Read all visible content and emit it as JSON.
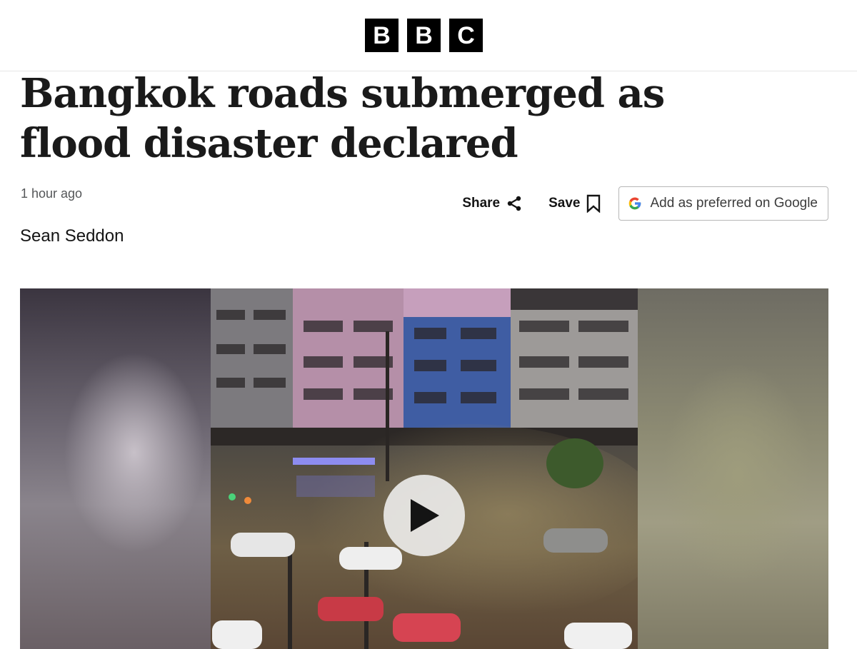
{
  "header": {
    "logo_letters": [
      "B",
      "B",
      "C"
    ]
  },
  "article": {
    "headline": "Bangkok roads submerged as flood disaster declared",
    "timestamp": "1 hour ago",
    "author": "Sean Seddon"
  },
  "actions": {
    "share_label": "Share",
    "save_label": "Save",
    "google_label": "Add as preferred on Google"
  },
  "media": {
    "type": "video",
    "icon": "play-icon"
  },
  "colors": {
    "logo_bg": "#000000",
    "text": "#141414",
    "muted_text": "#545658",
    "google_blue": "#4285F4",
    "google_red": "#EA4335",
    "google_yellow": "#FBBC05",
    "google_green": "#34A853"
  }
}
